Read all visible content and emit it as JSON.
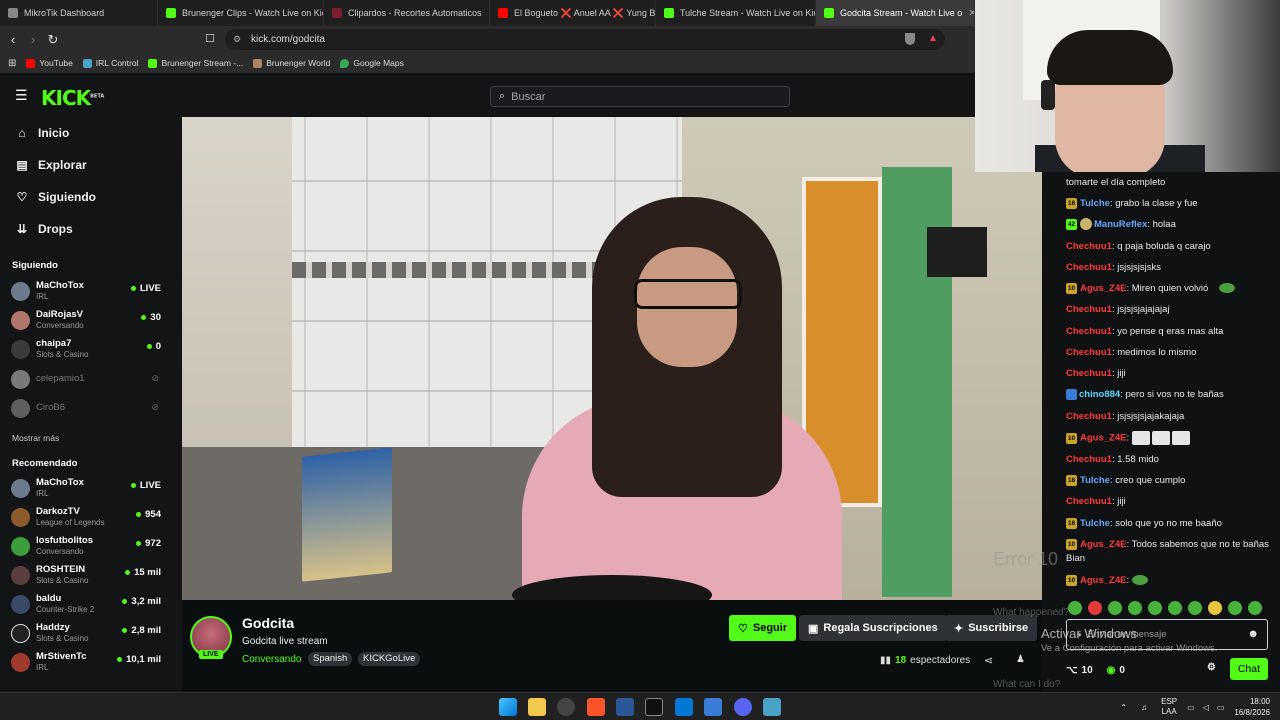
{
  "browser": {
    "tabs": [
      {
        "label": "MikroTik Dashboard",
        "icon": "mikrotik-icon"
      },
      {
        "label": "Brunenger Clips - Watch Live on Kick",
        "icon": "kick-icon"
      },
      {
        "label": "Clipardos - Recortes Automaticos",
        "icon": "clipardos-icon"
      },
      {
        "label": "El Bogueto ❌ Anuel AA ❌ Yung Be",
        "icon": "youtube-icon"
      },
      {
        "label": "Tulche Stream - Watch Live on Kick",
        "icon": "kick-icon"
      },
      {
        "label": "Godcita Stream - Watch Live o",
        "icon": "kick-icon",
        "active": true
      }
    ],
    "url": "kick.com/godcita",
    "bookmarks": [
      "YouTube",
      "IRL Control",
      "Brunenger Stream -...",
      "Brunenger World",
      "Google Maps"
    ]
  },
  "header": {
    "logo": "KICK",
    "logo_beta": "BETA",
    "search_placeholder": "Buscar"
  },
  "sidebar": {
    "nav": [
      "Inicio",
      "Explorar",
      "Siguiendo",
      "Drops"
    ],
    "following_title": "Siguiendo",
    "following": [
      {
        "name": "MaChoTox",
        "category": "IRL",
        "viewers": "LIVE"
      },
      {
        "name": "DaiRojasV",
        "category": "Conversando",
        "viewers": "30"
      },
      {
        "name": "chaipa7",
        "category": "Slots & Casino",
        "viewers": "0"
      },
      {
        "name": "celepamio1",
        "offline": true
      },
      {
        "name": "CiroB6",
        "offline": true
      }
    ],
    "show_more": "Mostrar más",
    "recommended_title": "Recomendado",
    "recommended": [
      {
        "name": "MaChoTox",
        "category": "IRL",
        "viewers": "LIVE"
      },
      {
        "name": "DarkozTV",
        "category": "League of Legends",
        "viewers": "954"
      },
      {
        "name": "losfutbolitos",
        "category": "Conversando",
        "viewers": "972"
      },
      {
        "name": "ROSHTEIN",
        "category": "Slots & Casino",
        "viewers": "15 mil"
      },
      {
        "name": "baldu",
        "category": "Counter-Strike 2",
        "viewers": "3,2 mil"
      },
      {
        "name": "Haddzy",
        "category": "Slots & Casino",
        "viewers": "2,8 mil"
      },
      {
        "name": "MrStivenTc",
        "category": "IRL",
        "viewers": "10,1 mil"
      }
    ]
  },
  "channel": {
    "name": "Godcita",
    "live_badge": "LIVE",
    "title": "Godcita live stream",
    "category": "Conversando",
    "tags": [
      "Spanish",
      "KICKGoLive"
    ],
    "follow_label": "Seguir",
    "gift_label": "Regala Suscripciones",
    "subscribe_label": "Suscribirse",
    "viewers_count": "18",
    "viewers_label": "espectadores"
  },
  "chat": {
    "partial_top": "tomarte el día completo",
    "messages": [
      {
        "badge": "18",
        "user": "Tulche",
        "color": "blue",
        "text": "grabo la clase y fue"
      },
      {
        "badge": "42",
        "user": "ManuReflex",
        "color": "blue",
        "text": "holaa"
      },
      {
        "user": "Chechuu1",
        "color": "red",
        "text": "q paja boluda q carajo"
      },
      {
        "user": "Chechuu1",
        "color": "red",
        "text": "jsjsjsjsjsks"
      },
      {
        "badge": "10",
        "user": "Agus_Z4E",
        "color": "red",
        "text": "Miren quien volvió"
      },
      {
        "user": "Chechuu1",
        "color": "red",
        "text": "jsjsjsjajajajaj"
      },
      {
        "user": "Chechuu1",
        "color": "red",
        "text": "yo pense q eras mas alta"
      },
      {
        "user": "Chechuu1",
        "color": "red",
        "text": "medimos lo mismo"
      },
      {
        "user": "Chechuu1",
        "color": "red",
        "text": "jiji"
      },
      {
        "user": "chino884",
        "color": "cyan",
        "text": "pero si vos no te bañas"
      },
      {
        "user": "Chechuu1",
        "color": "red",
        "text": "jsjsjsjsjajakajaja"
      },
      {
        "badge": "10",
        "user": "Agus_Z4E",
        "color": "red",
        "text": ""
      },
      {
        "user": "Chechuu1",
        "color": "red",
        "text": "1.58 mido"
      },
      {
        "badge": "18",
        "user": "Tulche",
        "color": "blue",
        "text": "creo que cumplo"
      },
      {
        "user": "Chechuu1",
        "color": "red",
        "text": "jiji"
      },
      {
        "badge": "18",
        "user": "Tulche",
        "color": "blue",
        "text": "solo que yo no me baaño"
      },
      {
        "badge": "10",
        "user": "Agus_Z4E",
        "color": "red",
        "text": "Todos sabemos que no te bañas Bian"
      },
      {
        "badge": "10",
        "user": "Agus_Z4E",
        "color": "red",
        "text": ""
      }
    ],
    "input_placeholder": "Enviar un mensaje",
    "points_1": "10",
    "points_2": "0",
    "send_label": "Chat"
  },
  "overlays": {
    "error_text": "Error 10",
    "windows_title": "Activar Windows",
    "windows_sub": "Ve a Configuración para activar Windows.",
    "what_happened": "What happened?",
    "what_can_i_do": "What can I do?"
  },
  "taskbar": {
    "lang_1": "ESP",
    "lang_2": "LAA",
    "time": "18:00",
    "date": "16/8/2026"
  },
  "colors": {
    "kick_green": "#53fc18",
    "chat_red": "#ff3b3b",
    "chat_blue": "#69a7ff"
  }
}
